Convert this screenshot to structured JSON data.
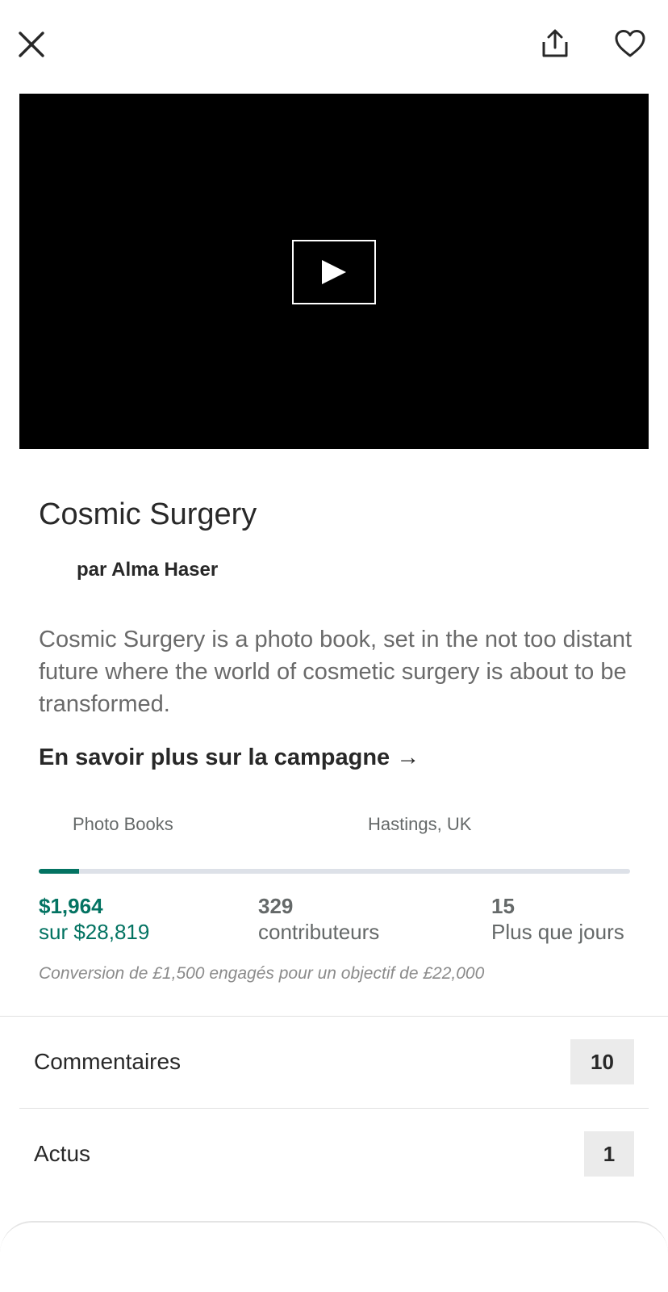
{
  "header": {
    "close_icon": "close-icon",
    "share_icon": "share-icon",
    "favorite_icon": "heart-icon"
  },
  "video": {
    "play_icon": "play-icon"
  },
  "project": {
    "title": "Cosmic Surgery",
    "byline": "par Alma Haser",
    "description": "Cosmic Surgery is a photo book, set in the not too distant future where the world of cosmetic surgery is about to be transformed.",
    "learn_more": "En savoir plus sur la campagne →",
    "category": "Photo Books",
    "location": "Hastings, UK"
  },
  "funding": {
    "progress_fraction": 0.068,
    "pledged": "$1,964",
    "goal": "sur $28,819",
    "backers_count": "329",
    "backers_label": "contributeurs",
    "days_count": "15",
    "days_label": "Plus que jours",
    "conversion_note": "Conversion de £1,500 engagés pour un objectif de £22,000"
  },
  "sections": {
    "comments_label": "Commentaires",
    "comments_count": "10",
    "updates_label": "Actus",
    "updates_count": "1"
  },
  "colors": {
    "accent": "#037362",
    "progress_track": "#dde1e8",
    "badge_bg": "#ebebeb"
  }
}
